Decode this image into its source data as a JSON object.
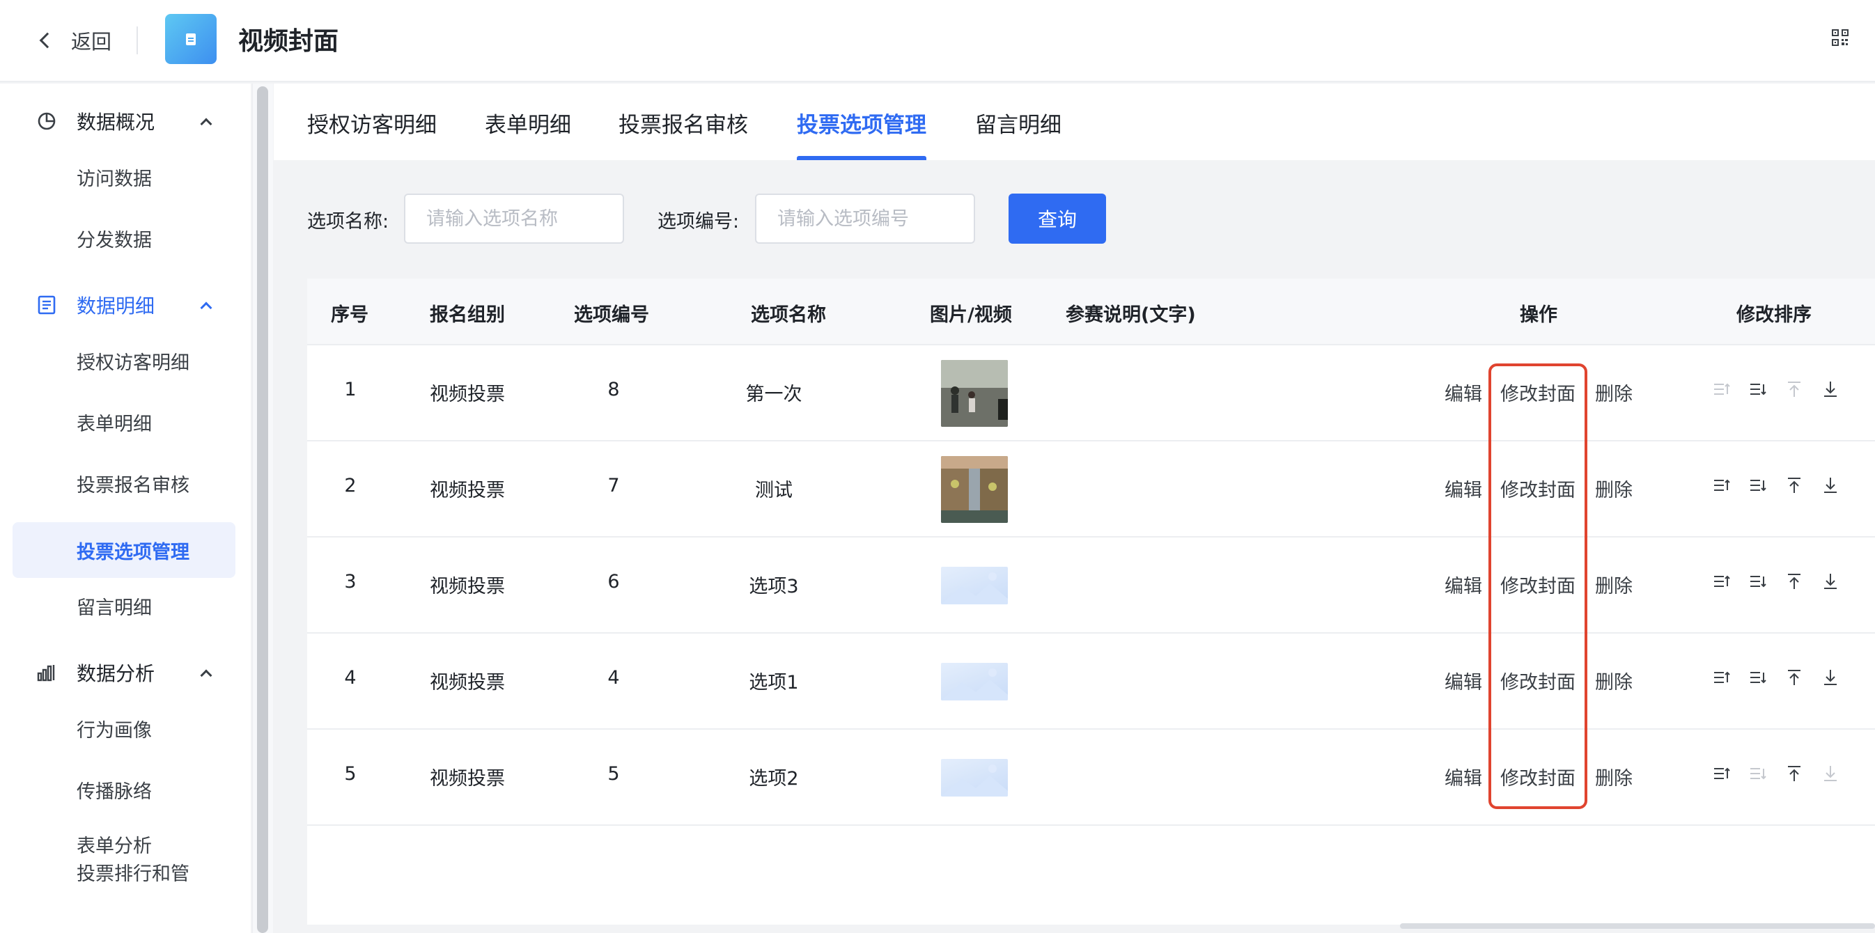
{
  "header": {
    "back_label": "返回",
    "title": "视频封面"
  },
  "sidebar": {
    "groups": [
      {
        "label": "数据概况",
        "icon": "pie-chart-icon",
        "items": [
          "访问数据",
          "分发数据"
        ]
      },
      {
        "label": "数据明细",
        "icon": "list-doc-icon",
        "items": [
          "授权访客明细",
          "表单明细",
          "投票报名审核",
          "投票选项管理",
          "留言明细"
        ]
      },
      {
        "label": "数据分析",
        "icon": "bar-chart-icon",
        "items": [
          "行为画像",
          "传播脉络",
          "表单分析",
          "投票排行和管"
        ]
      }
    ],
    "active_item": "投票选项管理"
  },
  "tabs": [
    "授权访客明细",
    "表单明细",
    "投票报名审核",
    "投票选项管理",
    "留言明细"
  ],
  "active_tab": "投票选项管理",
  "filters": {
    "name_label": "选项名称:",
    "name_placeholder": "请输入选项名称",
    "code_label": "选项编号:",
    "code_placeholder": "请输入选项编号",
    "query_label": "查询"
  },
  "table": {
    "headers": [
      "序号",
      "报名组别",
      "选项编号",
      "选项名称",
      "图片/视频",
      "参赛说明(文字)",
      "操作",
      "修改排序"
    ],
    "actions": {
      "edit": "编辑",
      "cover": "修改封面",
      "delete": "删除"
    },
    "rows": [
      {
        "no": "1",
        "group": "视频投票",
        "code": "8",
        "name": "第一次",
        "media": "photo-street"
      },
      {
        "no": "2",
        "group": "视频投票",
        "code": "7",
        "name": "测试",
        "media": "photo-aerial"
      },
      {
        "no": "3",
        "group": "视频投票",
        "code": "6",
        "name": "选项3",
        "media": "placeholder"
      },
      {
        "no": "4",
        "group": "视频投票",
        "code": "4",
        "name": "选项1",
        "media": "placeholder"
      },
      {
        "no": "5",
        "group": "视频投票",
        "code": "5",
        "name": "选项2",
        "media": "placeholder"
      }
    ]
  },
  "colors": {
    "accent": "#2f6bf2",
    "highlight_box": "#e0442f"
  }
}
